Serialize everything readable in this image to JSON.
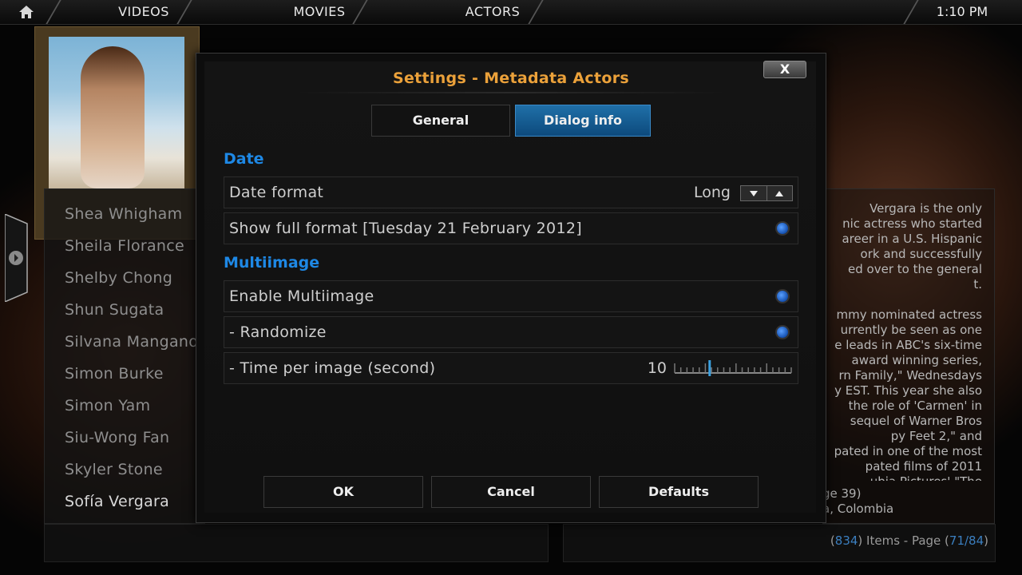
{
  "topbar": {
    "home_icon": "home-icon",
    "nav": [
      "VIDEOS",
      "MOVIES",
      "ACTORS"
    ],
    "clock": "1:10 PM"
  },
  "list": {
    "items": [
      "Shea Whigham",
      "Sheila Florance",
      "Shelby Chong",
      "Shun Sugata",
      "Silvana Mangano",
      "Simon Burke",
      "Simon Yam",
      "Siu-Wong Fan",
      "Skyler Stone",
      "Sofía Vergara"
    ],
    "selected": "Sofía Vergara"
  },
  "bio": {
    "lines": [
      "Vergara is the only",
      "nic actress who started",
      "areer in a U.S. Hispanic",
      "ork and successfully",
      "ed over to the general",
      "t.",
      "",
      "mmy nominated actress",
      "urrently be seen as one",
      "e leads in ABC's six-time",
      "award winning series,",
      "rn Family,\" Wednesdays",
      "y EST. This year she also",
      "the role of 'Carmen' in",
      "sequel of Warner Bros",
      "py Feet 2,\" and",
      "pated in one of the most",
      "pated films of 2011",
      "ubia Pictures' \"The"
    ],
    "age": "ge 39)",
    "birthplace": "a, Colombia"
  },
  "pageinfo": {
    "count": "834",
    "items_label": "Items - Page",
    "page": "71/84"
  },
  "dialog": {
    "title": "Settings - Metadata Actors",
    "close_label": "X",
    "tabs": [
      "General",
      "Dialog info"
    ],
    "active_tab": "Dialog info",
    "sections": {
      "date": "Date",
      "multiimage": "Multiimage"
    },
    "rows": {
      "date_format": {
        "label": "Date format",
        "value": "Long"
      },
      "show_full": {
        "label": "Show full format [Tuesday 21 February 2012]",
        "checked": true
      },
      "enable_multi": {
        "label": "Enable Multiimage",
        "checked": true
      },
      "randomize": {
        "label": "- Randomize",
        "checked": true
      },
      "time_per_image": {
        "label": "- Time per image (second)",
        "value": "10",
        "slider_fraction": 0.3
      }
    },
    "buttons": {
      "ok": "OK",
      "cancel": "Cancel",
      "defaults": "Defaults"
    }
  },
  "colors": {
    "title": "#eba13a",
    "section": "#1e88e5",
    "tab_active": "#1f6fa8",
    "radio": "#1450b0"
  }
}
